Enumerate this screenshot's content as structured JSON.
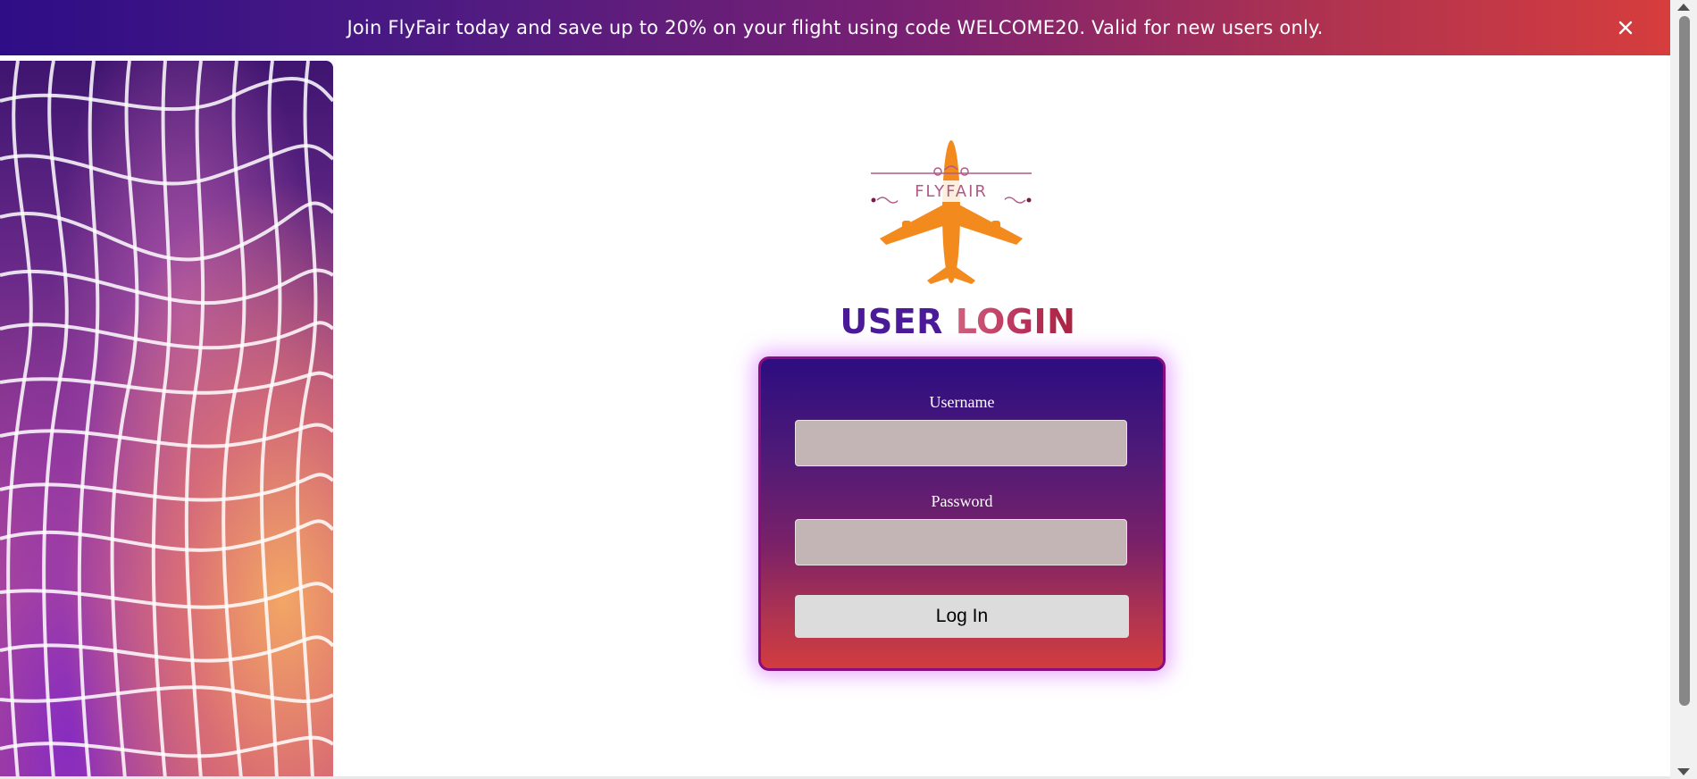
{
  "banner": {
    "text": "Join FlyFair today and save up to 20% on your flight using code WELCOME20. Valid for new users only.",
    "close_icon": "close-icon"
  },
  "brand": {
    "logo_text": "FLYFAIR",
    "logo_icon": "airplane-logo-icon"
  },
  "login": {
    "title_part1": "USER",
    "title_part2": "LOGIN",
    "username_label": "Username",
    "username_value": "",
    "password_label": "Password",
    "password_value": "",
    "submit_label": "Log In"
  },
  "colors": {
    "banner_start": "#2e0d86",
    "banner_end": "#d63d3d",
    "logo_orange": "#f28a1e",
    "title_purple": "#4a1a98",
    "title_red": "#b8305a",
    "card_border": "#8a0c80",
    "input_bg": "#c3b5b6",
    "button_bg": "#dcdcdc"
  }
}
